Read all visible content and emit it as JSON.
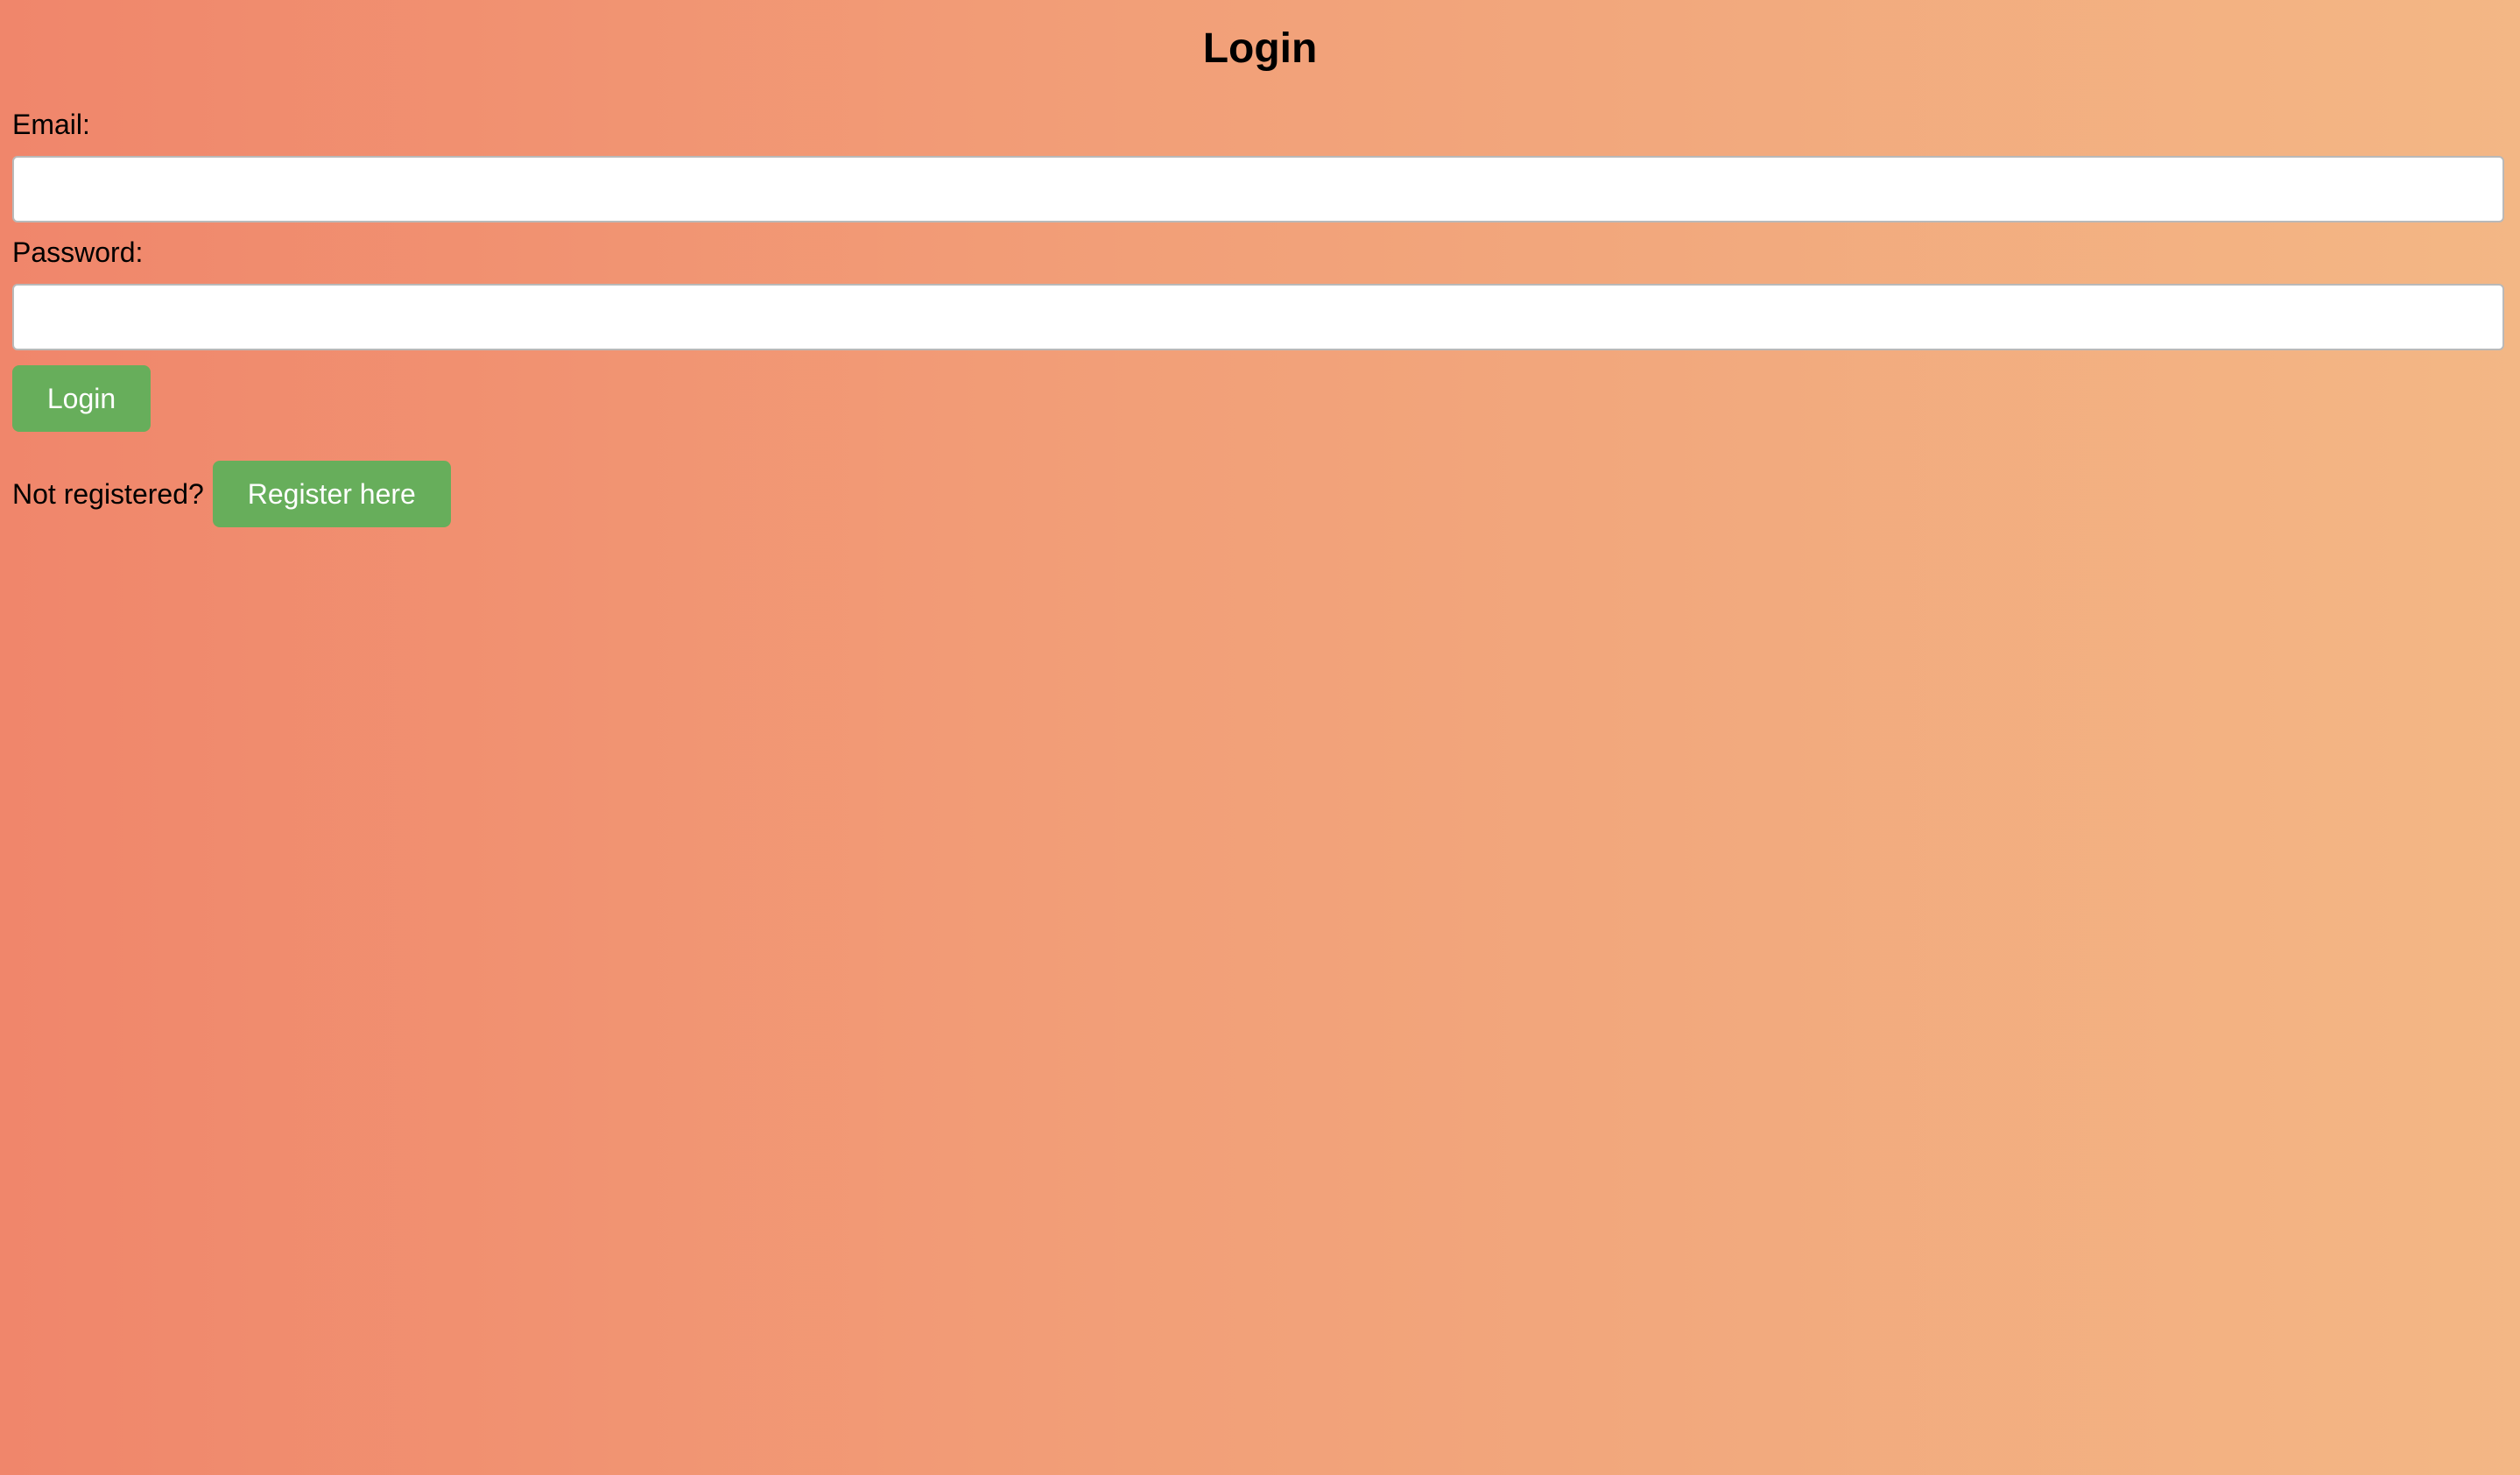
{
  "header": {
    "title": "Login"
  },
  "form": {
    "email_label": "Email:",
    "email_value": "",
    "email_placeholder": "",
    "password_label": "Password:",
    "password_value": "",
    "password_placeholder": "",
    "login_button_label": "Login"
  },
  "register": {
    "prompt": "Not registered?",
    "button_label": "Register here"
  },
  "colors": {
    "background_start": "#f0866b",
    "background_end": "#f3b785",
    "button": "#67ae5b",
    "button_text": "#ffffff"
  }
}
